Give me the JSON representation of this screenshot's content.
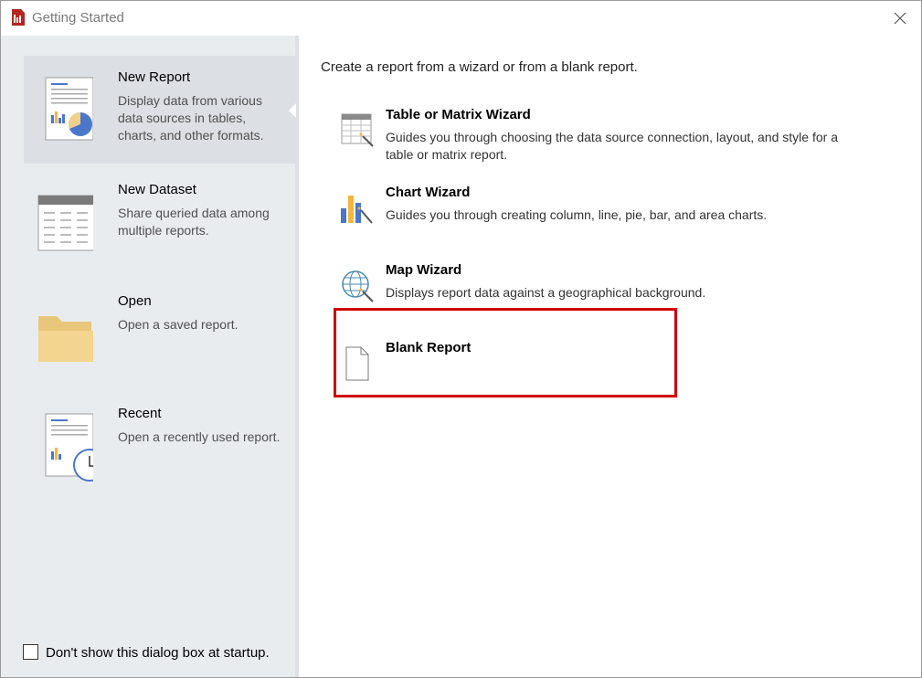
{
  "window": {
    "title": "Getting Started"
  },
  "nav": [
    {
      "title": "New Report",
      "desc": "Display data from various data sources in tables, charts, and other formats.",
      "icon": "new-report-icon",
      "selected": true
    },
    {
      "title": "New Dataset",
      "desc": "Share queried data among multiple reports.",
      "icon": "dataset-icon",
      "selected": false
    },
    {
      "title": "Open",
      "desc": "Open a saved report.",
      "icon": "folder-icon",
      "selected": false
    },
    {
      "title": "Recent",
      "desc": "Open a recently used report.",
      "icon": "recent-report-icon",
      "selected": false
    }
  ],
  "startup": {
    "label": "Don't show this dialog box at startup.",
    "checked": false
  },
  "main": {
    "intro": "Create a report from a wizard or from a blank report.",
    "options": [
      {
        "title": "Table or Matrix Wizard",
        "desc": "Guides you through choosing the data source connection, layout, and style for a table or matrix report.",
        "icon": "table-wizard-icon"
      },
      {
        "title": "Chart Wizard",
        "desc": "Guides you through creating column, line, pie, bar, and area charts.",
        "icon": "chart-wizard-icon"
      },
      {
        "title": "Map Wizard",
        "desc": "Displays report data against a geographical background.",
        "icon": "map-wizard-icon"
      },
      {
        "title": "Blank Report",
        "desc": "",
        "icon": "blank-page-icon"
      }
    ]
  },
  "colors": {
    "highlight": "#d00000",
    "left_pane": "#e9ecef",
    "selected": "#dcdfe3"
  }
}
